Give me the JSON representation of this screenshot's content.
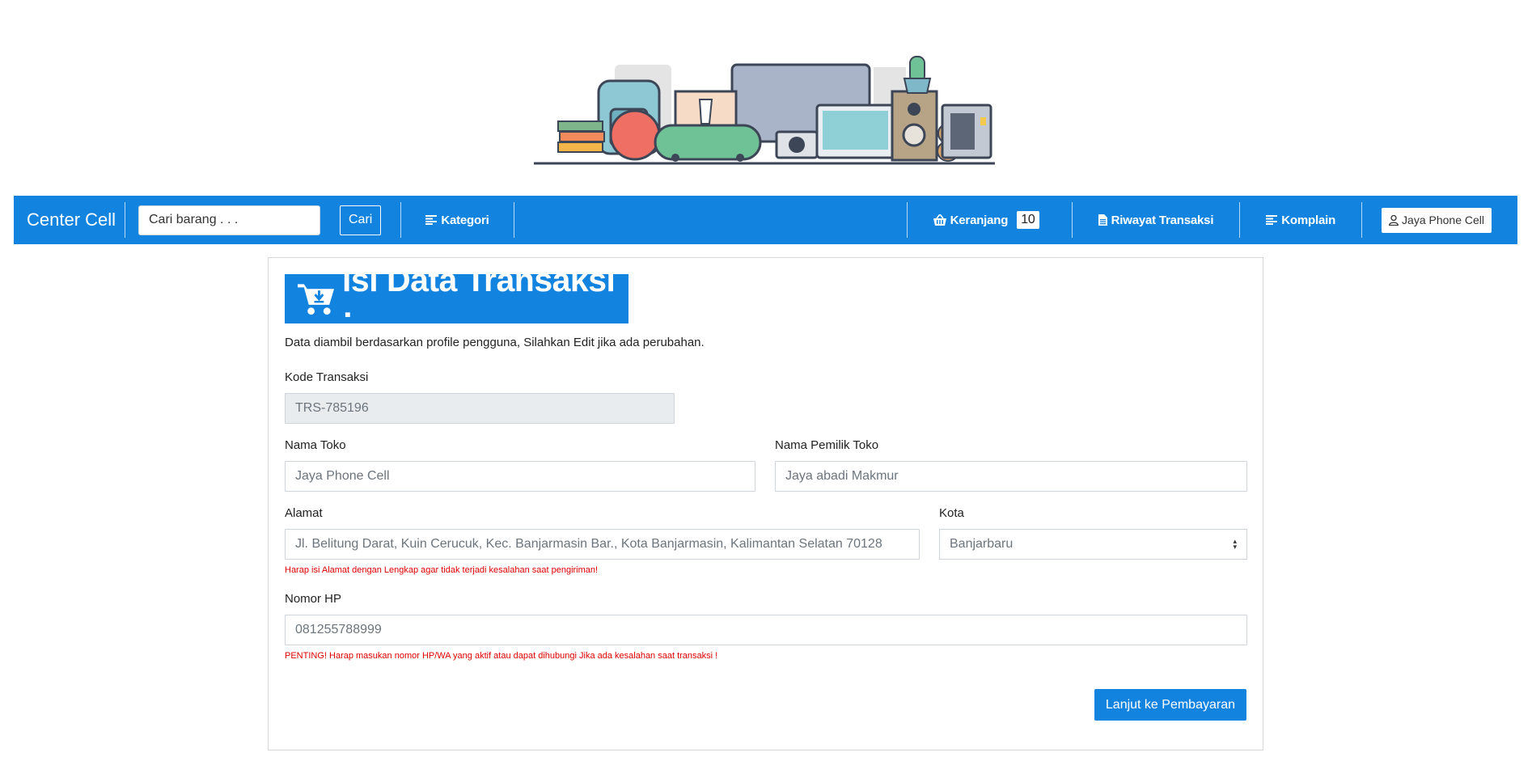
{
  "navbar": {
    "brand": "Center Cell",
    "search_placeholder": "Cari barang . . .",
    "search_button": "Cari",
    "kategori": "Kategori",
    "keranjang": "Keranjang",
    "keranjang_count": "10",
    "riwayat": "Riwayat Transaksi",
    "komplain": "Komplain",
    "user": "Jaya Phone Cell"
  },
  "form": {
    "title": "isi Data Transaksi :",
    "subtitle": "Data diambil berdasarkan profile pengguna, Silahkan Edit jika ada perubahan.",
    "kode_label": "Kode Transaksi",
    "kode_value": "TRS-785196",
    "nama_toko_label": "Nama Toko",
    "nama_toko_value": "Jaya Phone Cell",
    "pemilik_label": "Nama Pemilik Toko",
    "pemilik_value": "Jaya abadi Makmur",
    "alamat_label": "Alamat",
    "alamat_value": "Jl. Belitung Darat, Kuin Cerucuk, Kec. Banjarmasin Bar., Kota Banjarmasin, Kalimantan Selatan 70128",
    "alamat_warning": "Harap isi Alamat dengan Lengkap agar tidak terjadi kesalahan saat pengiriman!",
    "kota_label": "Kota",
    "kota_value": "Banjarbaru",
    "hp_label": "Nomor HP",
    "hp_value": "081255788999",
    "hp_warning": "PENTING! Harap masukan nomor HP/WA yang aktif atau dapat dihubungi Jika ada kesalahan saat transaksi !",
    "submit": "Lanjut ke Pembayaran"
  },
  "colors": {
    "primary": "#1383e0",
    "warning": "#e00000"
  }
}
